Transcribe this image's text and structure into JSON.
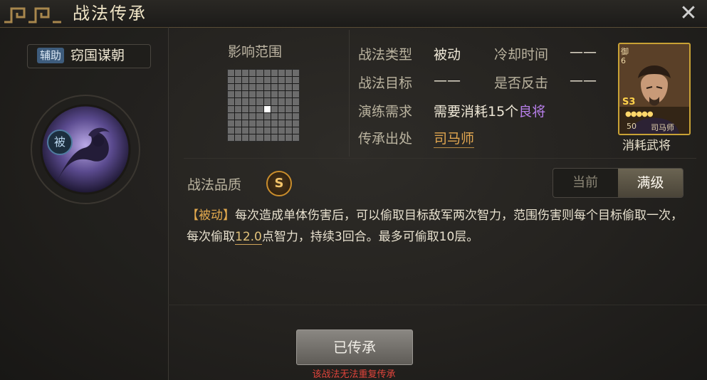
{
  "header": {
    "title": "战法传承",
    "close_icon": "close-icon"
  },
  "skill": {
    "type_tag": "辅助",
    "name": "窃国谋朝",
    "passive_badge": "被",
    "emblem_icon": "passive-skill-emblem-icon"
  },
  "range": {
    "label": "影响范围",
    "grid_size": 10,
    "center_cell": [
      5,
      5
    ]
  },
  "info": {
    "type_label": "战法类型",
    "type_value": "被动",
    "cooldown_label": "冷却时间",
    "cooldown_value": "——",
    "target_label": "战法目标",
    "target_value": "——",
    "counter_label": "是否反击",
    "counter_value": "——",
    "req_label": "演练需求",
    "req_prefix": "需要消耗15个",
    "req_highlight": "良将",
    "source_label": "传承出处",
    "source_value": "司马师"
  },
  "hero_card": {
    "side_text": "御6",
    "stars_text": "●●●●●",
    "s3": "S3",
    "level": "50",
    "hero_name": "司马师",
    "portrait_icon": "hero-portrait-icon"
  },
  "consume_label": "消耗武将",
  "quality": {
    "label": "战法品质",
    "grade": "S"
  },
  "tabs": {
    "current": "当前",
    "max": "满级",
    "active": "max"
  },
  "description": {
    "tag": "【被动】",
    "text1": "每次造成单体伤害后，可以偷取目标敌军两次智力，范围伤害则每个目标偷取一次，每次偷取",
    "value": "12.0",
    "text2": "点智力，持续3回合。最多可偷取10层。"
  },
  "bottom": {
    "button_label": "已传承",
    "notice": "该战法无法重复传承"
  },
  "colors": {
    "accent_gold": "#e1a650",
    "highlight_purple": "#b67ee8",
    "notice_red": "#e0443b",
    "tag_blue": "#3e5c7c"
  }
}
